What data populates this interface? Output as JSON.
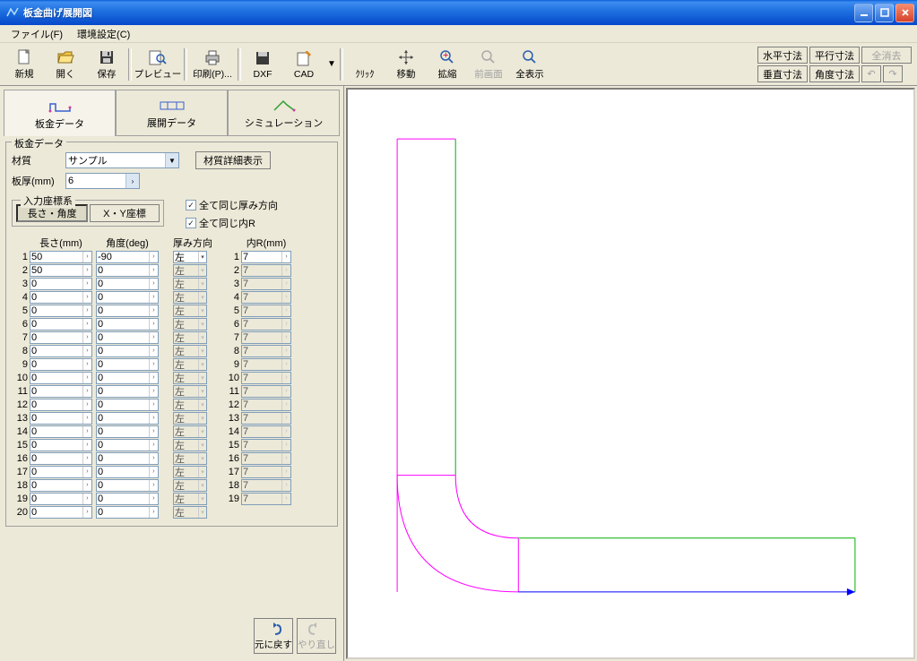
{
  "window": {
    "title": "板金曲げ展開図"
  },
  "menu": {
    "file": "ファイル(F)",
    "env": "環境設定(C)"
  },
  "toolbar": {
    "new": "新規",
    "open": "開く",
    "save": "保存",
    "preview": "プレビュー",
    "print": "印刷(P)...",
    "dxf": "DXF",
    "cad": "CAD",
    "click": "ｸﾘｯｸ",
    "move": "移動",
    "zoom": "拡縮",
    "prev": "前画面",
    "all": "全表示"
  },
  "dims": {
    "horiz": "水平寸法",
    "para": "平行寸法",
    "clear": "全消去",
    "vert": "垂直寸法",
    "angle": "角度寸法"
  },
  "tabs": {
    "sheet": "板金データ",
    "unfold": "展開データ",
    "sim": "シミュレーション"
  },
  "panel": {
    "group": "板金データ",
    "material": "材質",
    "material_value": "サンプル",
    "material_detail": "材質詳細表示",
    "thickness": "板厚(mm)",
    "thickness_value": "6",
    "coord_group": "入力座標系",
    "coord_len": "長さ・角度",
    "coord_xy": "X・Y座標",
    "same_thick": "全て同じ厚み方向",
    "same_r": "全て同じ内R",
    "col_len": "長さ(mm)",
    "col_ang": "角度(deg)",
    "col_thick": "厚み方向",
    "col_r": "内R(mm)",
    "thick_opt": "左"
  },
  "grid": {
    "len": [
      "50",
      "50",
      "0",
      "0",
      "0",
      "0",
      "0",
      "0",
      "0",
      "0",
      "0",
      "0",
      "0",
      "0",
      "0",
      "0",
      "0",
      "0",
      "0",
      "0"
    ],
    "ang": [
      "-90",
      "0",
      "0",
      "0",
      "0",
      "0",
      "0",
      "0",
      "0",
      "0",
      "0",
      "0",
      "0",
      "0",
      "0",
      "0",
      "0",
      "0",
      "0",
      "0"
    ],
    "thick": [
      "左",
      "左",
      "左",
      "左",
      "左",
      "左",
      "左",
      "左",
      "左",
      "左",
      "左",
      "左",
      "左",
      "左",
      "左",
      "左",
      "左",
      "左",
      "左",
      "左"
    ],
    "r": [
      "7",
      "7",
      "7",
      "7",
      "7",
      "7",
      "7",
      "7",
      "7",
      "7",
      "7",
      "7",
      "7",
      "7",
      "7",
      "7",
      "7",
      "7",
      "7"
    ]
  },
  "footer": {
    "undo": "元に戻す",
    "redo": "やり直し"
  },
  "chart_data": {
    "type": "diagram",
    "description": "L-shaped sheet metal bend profile, vertical segment joined to horizontal segment via inner radius",
    "units": "mm",
    "segments": [
      {
        "length": 50,
        "angle": -90
      },
      {
        "length": 50,
        "angle": 0
      }
    ],
    "thickness": 6,
    "inner_radius": 7,
    "colors": {
      "outline_v": "#ff00ff",
      "outline_h_top": "#00c000",
      "outline_h_end": "#0000ff",
      "bend_arc": "#ff00ff"
    }
  }
}
